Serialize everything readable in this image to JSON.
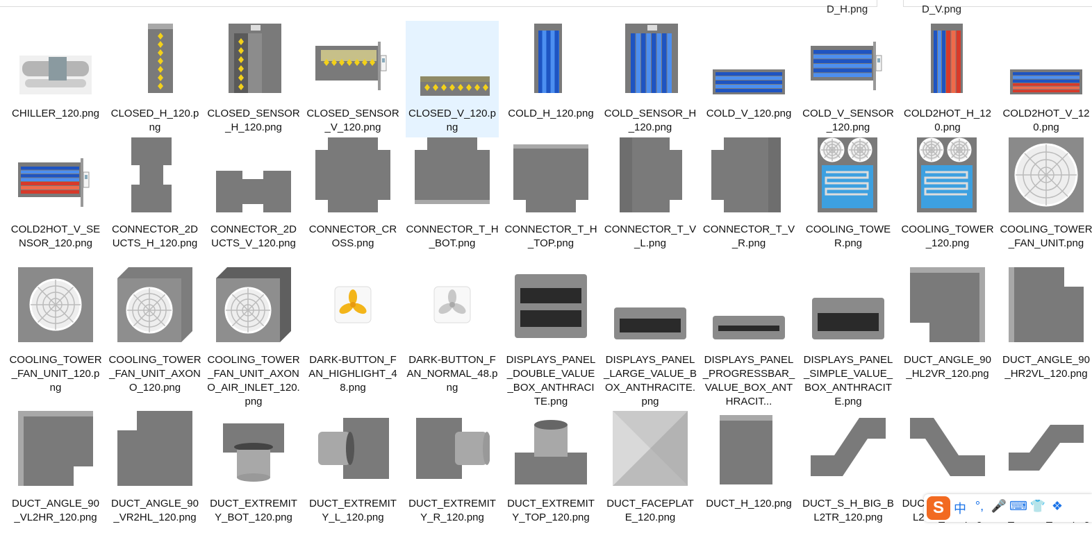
{
  "top_cut_labels": [
    "D_H.png",
    "D_V.png"
  ],
  "files": [
    {
      "name": "CHILLER_120.png",
      "icon": "chiller-icon"
    },
    {
      "name": "CLOSED_H_120.png",
      "icon": "closed-h-icon"
    },
    {
      "name": "CLOSED_SENSOR_H_120.png",
      "icon": "closed-sensor-h-icon"
    },
    {
      "name": "CLOSED_SENSOR_V_120.png",
      "icon": "closed-sensor-v-icon"
    },
    {
      "name": "CLOSED_V_120.png",
      "icon": "closed-v-icon",
      "selected": true
    },
    {
      "name": "COLD_H_120.png",
      "icon": "cold-h-icon"
    },
    {
      "name": "COLD_SENSOR_H_120.png",
      "icon": "cold-sensor-h-icon"
    },
    {
      "name": "COLD_V_120.png",
      "icon": "cold-v-icon"
    },
    {
      "name": "COLD_V_SENSOR_120.png",
      "icon": "cold-v-sensor-icon"
    },
    {
      "name": "COLD2HOT_H_120.png",
      "icon": "cold2hot-h-icon"
    },
    {
      "name": "COLD2HOT_V_120.png",
      "icon": "cold2hot-v-icon"
    },
    {
      "name": "COLD2HOT_V_SENSOR_120.png",
      "icon": "cold2hot-v-sensor-icon"
    },
    {
      "name": "CONNECTOR_2DUCTS_H_120.png",
      "icon": "connector-2ducts-h-icon"
    },
    {
      "name": "CONNECTOR_2DUCTS_V_120.png",
      "icon": "connector-2ducts-v-icon"
    },
    {
      "name": "CONNECTOR_CROSS.png",
      "icon": "connector-cross-icon"
    },
    {
      "name": "CONNECTOR_T_H_BOT.png",
      "icon": "connector-t-h-bot-icon"
    },
    {
      "name": "CONNECTOR_T_H_TOP.png",
      "icon": "connector-t-h-top-icon"
    },
    {
      "name": "CONNECTOR_T_V_L.png",
      "icon": "connector-t-v-l-icon"
    },
    {
      "name": "CONNECTOR_T_V_R.png",
      "icon": "connector-t-v-r-icon"
    },
    {
      "name": "COOLING_TOWER.png",
      "icon": "cooling-tower-icon"
    },
    {
      "name": "COOLING_TOWER_120.png",
      "icon": "cooling-tower-120-icon"
    },
    {
      "name": "COOLING_TOWER_FAN_UNIT.png",
      "icon": "cooling-tower-fan-unit-icon"
    },
    {
      "name": "COOLING_TOWER_FAN_UNIT_120.png",
      "icon": "cooling-tower-fan-unit-120-icon"
    },
    {
      "name": "COOLING_TOWER_FAN_UNIT_AXONO_120.png",
      "icon": "fan-unit-axono-icon"
    },
    {
      "name": "COOLING_TOWER_FAN_UNIT_AXONO_AIR_INLET_120.png",
      "icon": "fan-unit-axono-air-inlet-icon"
    },
    {
      "name": "DARK-BUTTON_FAN_HIGHLIGHT_48.png",
      "icon": "fan-highlight-icon"
    },
    {
      "name": "DARK-BUTTON_FAN_NORMAL_48.png",
      "icon": "fan-normal-icon"
    },
    {
      "name": "DISPLAYS_PANEL_DOUBLE_VALUE_BOX_ANTHRACITE.png",
      "icon": "panel-double-value-icon"
    },
    {
      "name": "DISPLAYS_PANEL_LARGE_VALUE_BOX_ANTHRACITE.png",
      "icon": "panel-large-value-icon"
    },
    {
      "name": "DISPLAYS_PANEL_PROGRESSBAR_VALUE_BOX_ANTHRACIT...",
      "icon": "panel-progressbar-icon"
    },
    {
      "name": "DISPLAYS_PANEL_SIMPLE_VALUE_BOX_ANTHRACITE.png",
      "icon": "panel-simple-value-icon"
    },
    {
      "name": "DUCT_ANGLE_90_HL2VR_120.png",
      "icon": "duct-angle-hl2vr-icon"
    },
    {
      "name": "DUCT_ANGLE_90_HR2VL_120.png",
      "icon": "duct-angle-hr2vl-icon"
    },
    {
      "name": "DUCT_ANGLE_90_VL2HR_120.png",
      "icon": "duct-angle-vl2hr-icon"
    },
    {
      "name": "DUCT_ANGLE_90_VR2HL_120.png",
      "icon": "duct-angle-vr2hl-icon"
    },
    {
      "name": "DUCT_EXTREMITY_BOT_120.png",
      "icon": "duct-extremity-bot-icon"
    },
    {
      "name": "DUCT_EXTREMITY_L_120.png",
      "icon": "duct-extremity-l-icon"
    },
    {
      "name": "DUCT_EXTREMITY_R_120.png",
      "icon": "duct-extremity-r-icon"
    },
    {
      "name": "DUCT_EXTREMITY_TOP_120.png",
      "icon": "duct-extremity-top-icon"
    },
    {
      "name": "DUCT_FACEPLATE_120.png",
      "icon": "duct-faceplate-icon"
    },
    {
      "name": "DUCT_H_120.png",
      "icon": "duct-h-icon"
    },
    {
      "name": "DUCT_S_H_BIG_BL2TR_120.png",
      "icon": "duct-s-h-big-bl2tr-icon"
    },
    {
      "name": "DUCT_S_H_BIG_TL2BR_120.png",
      "icon": "duct-s-h-big-tl2br-icon"
    },
    {
      "name": "DUCT_S_H_SMALL_BL2TR_120.png",
      "icon": "duct-s-h-small-bl2tr-icon"
    }
  ],
  "ime_toolbar": {
    "logo": "S",
    "items": [
      {
        "label": "中",
        "icon": "chinese-mode-icon"
      },
      {
        "label": "°,",
        "icon": "punctuation-icon"
      },
      {
        "label": "🎤",
        "icon": "microphone-icon"
      },
      {
        "label": "⌨",
        "icon": "keyboard-icon"
      },
      {
        "label": "👕",
        "icon": "skin-icon"
      },
      {
        "label": "❖",
        "icon": "toolbox-icon"
      }
    ]
  }
}
